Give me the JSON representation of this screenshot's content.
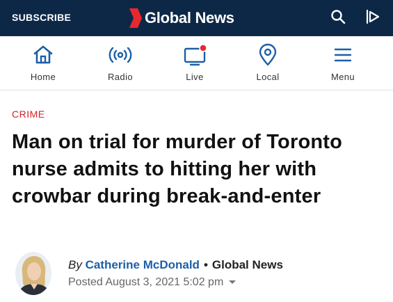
{
  "header": {
    "subscribe_label": "SUBSCRIBE",
    "brand": "Global News",
    "brand_color": "#e8282f",
    "background": "#0d2847",
    "icons": [
      "search-icon",
      "play-icon"
    ]
  },
  "nav": {
    "items": [
      {
        "label": "Home",
        "icon": "home-icon"
      },
      {
        "label": "Radio",
        "icon": "radio-icon"
      },
      {
        "label": "Live",
        "icon": "live-tv-icon"
      },
      {
        "label": "Local",
        "icon": "location-pin-icon"
      },
      {
        "label": "Menu",
        "icon": "hamburger-menu-icon"
      }
    ],
    "icon_color": "#1c5fa8",
    "live_dot_color": "#e8282f"
  },
  "article": {
    "category": "CRIME",
    "headline": "Man on trial for murder of Toronto nurse admits to hitting her with crowbar during break-and-enter",
    "byline": {
      "by": "By",
      "author": "Catherine McDonald",
      "separator": "•",
      "source": "Global News",
      "posted": "Posted August 3, 2021 5:02 pm"
    }
  }
}
